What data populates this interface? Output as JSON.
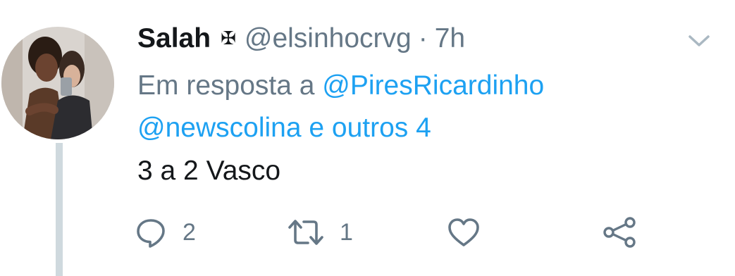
{
  "tweet": {
    "author_name": "Salah",
    "author_flag": "✠",
    "handle": "@elsinhocrvg",
    "separator": "·",
    "time": "7h",
    "reply_prefix": "Em resposta a",
    "reply_mention": "@PiresRicardinho",
    "reply_mention_2": "@newscolina",
    "reply_suffix": "e outros 4",
    "text": "3 a 2 Vasco"
  },
  "actions": {
    "reply_count": "2",
    "retweet_count": "1"
  },
  "icons": {
    "caret": "chevron-down-icon",
    "reply": "reply-icon",
    "retweet": "retweet-icon",
    "like": "heart-icon",
    "share": "share-icon"
  },
  "colors": {
    "link": "#1da1f2",
    "muted": "#657786",
    "text": "#14171a",
    "thread_line": "#cfd9de"
  }
}
